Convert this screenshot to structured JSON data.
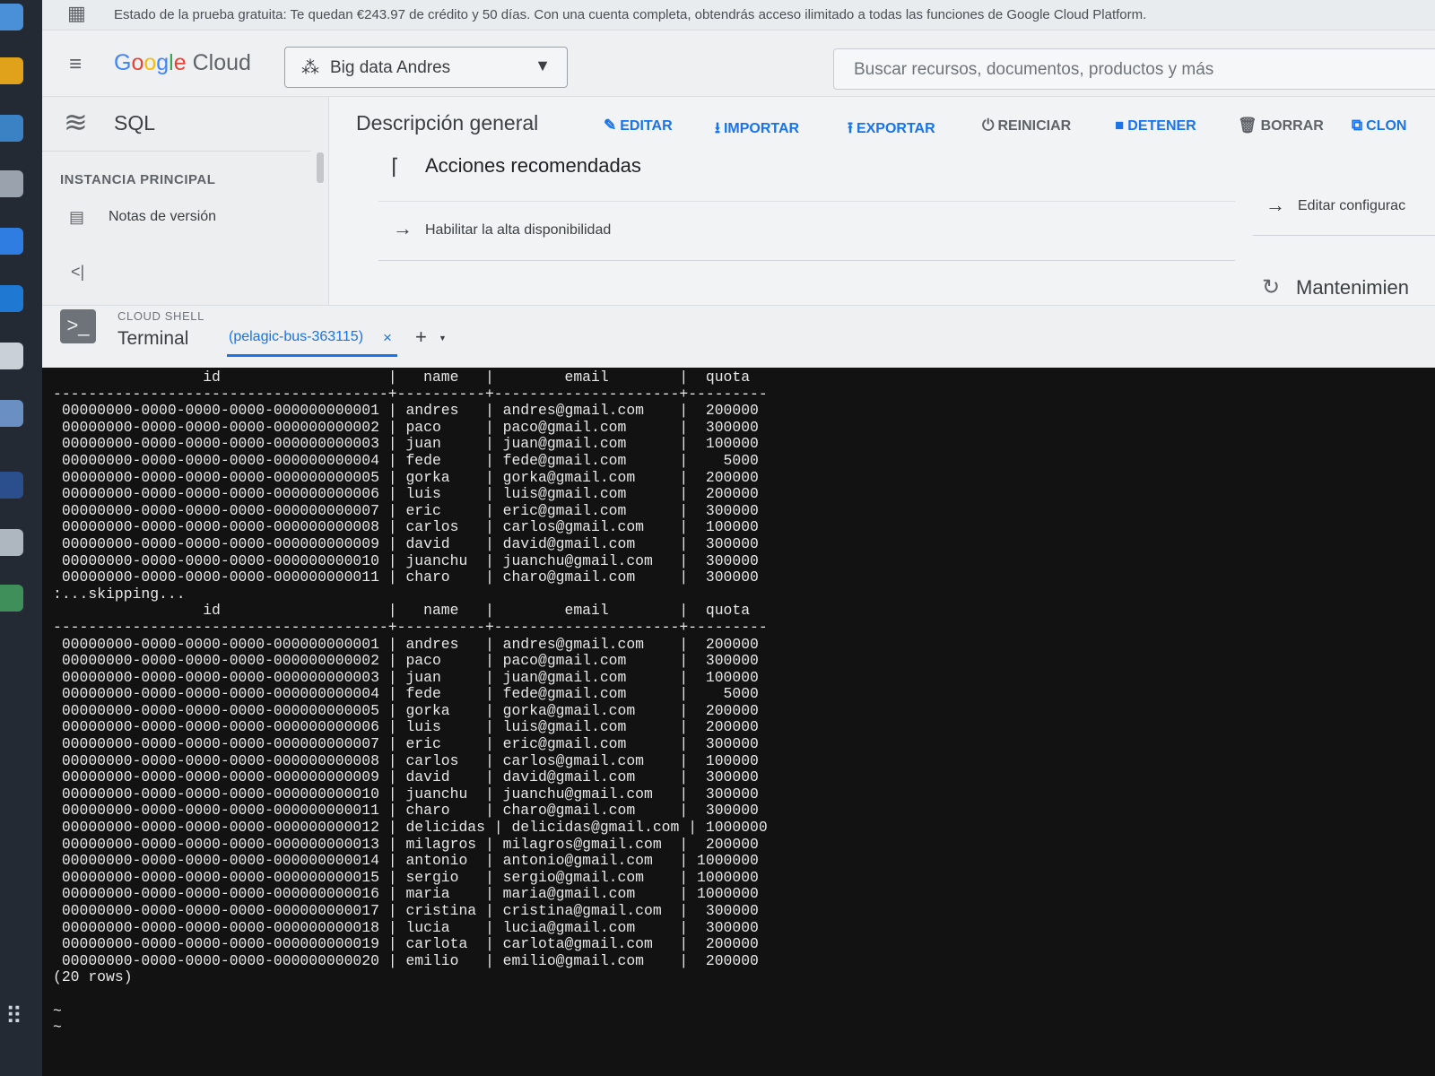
{
  "banner": {
    "text": "Estado de la prueba gratuita: Te quedan €243.97 de crédito y 50 días. Con una cuenta completa, obtendrás acceso ilimitado a todas las funciones de Google Cloud Platform."
  },
  "topbar": {
    "logo_google": [
      "G",
      "o",
      "o",
      "g",
      "l",
      "e"
    ],
    "logo_cloud": "Cloud",
    "project_name": "Big data Andres",
    "search_placeholder": "Buscar recursos, documentos, productos y más"
  },
  "leftnav": {
    "product": "SQL",
    "section_label": "INSTANCIA PRINCIPAL",
    "items": [
      {
        "label": "Notas de versión",
        "icon": "release-notes-icon"
      }
    ],
    "collapse_glyph": "<|"
  },
  "content": {
    "page_title": "Descripción general",
    "actions": [
      {
        "label": "EDITAR",
        "icon": "edit-icon",
        "glyph": "✎",
        "style": "blue"
      },
      {
        "label": "IMPORTAR",
        "icon": "import-icon",
        "glyph": "⭳",
        "style": "blue"
      },
      {
        "label": "EXPORTAR",
        "icon": "export-icon",
        "glyph": "⭱",
        "style": "blue"
      },
      {
        "label": "REINICIAR",
        "icon": "restart-icon",
        "glyph": "⏻",
        "style": "grey"
      },
      {
        "label": "DETENER",
        "icon": "stop-icon",
        "glyph": "■",
        "style": "grey"
      },
      {
        "label": "BORRAR",
        "icon": "delete-icon",
        "glyph": "🗑",
        "style": "grey"
      },
      {
        "label": "CLON",
        "icon": "clone-icon",
        "glyph": "⧉",
        "style": "blue"
      }
    ],
    "recommended": {
      "title": "Acciones recomendadas",
      "item": "Habilitar la alta disponibilidad"
    },
    "right_panel": {
      "edit_config": "Editar configurac",
      "maintenance": "Mantenimien"
    }
  },
  "cloud_shell": {
    "label": "CLOUD SHELL",
    "terminal_label": "Terminal",
    "tab_name": "(pelagic-bus-363115)",
    "tab_close": "×",
    "add_tab": "+"
  },
  "terminal": {
    "lines": [
      "                 id                   |   name   |        email        |  quota",
      "--------------------------------------+----------+---------------------+---------",
      " 00000000-0000-0000-0000-000000000001 | andres   | andres@gmail.com    |  200000",
      " 00000000-0000-0000-0000-000000000002 | paco     | paco@gmail.com      |  300000",
      " 00000000-0000-0000-0000-000000000003 | juan     | juan@gmail.com      |  100000",
      " 00000000-0000-0000-0000-000000000004 | fede     | fede@gmail.com      |    5000",
      " 00000000-0000-0000-0000-000000000005 | gorka    | gorka@gmail.com     |  200000",
      " 00000000-0000-0000-0000-000000000006 | luis     | luis@gmail.com      |  200000",
      " 00000000-0000-0000-0000-000000000007 | eric     | eric@gmail.com      |  300000",
      " 00000000-0000-0000-0000-000000000008 | carlos   | carlos@gmail.com    |  100000",
      " 00000000-0000-0000-0000-000000000009 | david    | david@gmail.com     |  300000",
      " 00000000-0000-0000-0000-000000000010 | juanchu  | juanchu@gmail.com   |  300000",
      " 00000000-0000-0000-0000-000000000011 | charo    | charo@gmail.com     |  300000",
      ":...skipping...",
      "                 id                   |   name   |        email        |  quota",
      "--------------------------------------+----------+---------------------+---------",
      " 00000000-0000-0000-0000-000000000001 | andres   | andres@gmail.com    |  200000",
      " 00000000-0000-0000-0000-000000000002 | paco     | paco@gmail.com      |  300000",
      " 00000000-0000-0000-0000-000000000003 | juan     | juan@gmail.com      |  100000",
      " 00000000-0000-0000-0000-000000000004 | fede     | fede@gmail.com      |    5000",
      " 00000000-0000-0000-0000-000000000005 | gorka    | gorka@gmail.com     |  200000",
      " 00000000-0000-0000-0000-000000000006 | luis     | luis@gmail.com      |  200000",
      " 00000000-0000-0000-0000-000000000007 | eric     | eric@gmail.com      |  300000",
      " 00000000-0000-0000-0000-000000000008 | carlos   | carlos@gmail.com    |  100000",
      " 00000000-0000-0000-0000-000000000009 | david    | david@gmail.com     |  300000",
      " 00000000-0000-0000-0000-000000000010 | juanchu  | juanchu@gmail.com   |  300000",
      " 00000000-0000-0000-0000-000000000011 | charo    | charo@gmail.com     |  300000",
      " 00000000-0000-0000-0000-000000000012 | delicidas | delicidas@gmail.com | 1000000",
      " 00000000-0000-0000-0000-000000000013 | milagros | milagros@gmail.com  |  200000",
      " 00000000-0000-0000-0000-000000000014 | antonio  | antonio@gmail.com   | 1000000",
      " 00000000-0000-0000-0000-000000000015 | sergio   | sergio@gmail.com    | 1000000",
      " 00000000-0000-0000-0000-000000000016 | maria    | maria@gmail.com     | 1000000",
      " 00000000-0000-0000-0000-000000000017 | cristina | cristina@gmail.com  |  300000",
      " 00000000-0000-0000-0000-000000000018 | lucia    | lucia@gmail.com     |  300000",
      " 00000000-0000-0000-0000-000000000019 | carlota  | carlota@gmail.com   |  200000",
      " 00000000-0000-0000-0000-000000000020 | emilio   | emilio@gmail.com    |  200000",
      "(20 rows)",
      "",
      "~",
      "~"
    ]
  },
  "colors": {
    "accent": "#1a73e8",
    "terminal_bg": "#121212",
    "terminal_fg": "#e8e8e8",
    "console_bg": "#f1f3f4"
  }
}
